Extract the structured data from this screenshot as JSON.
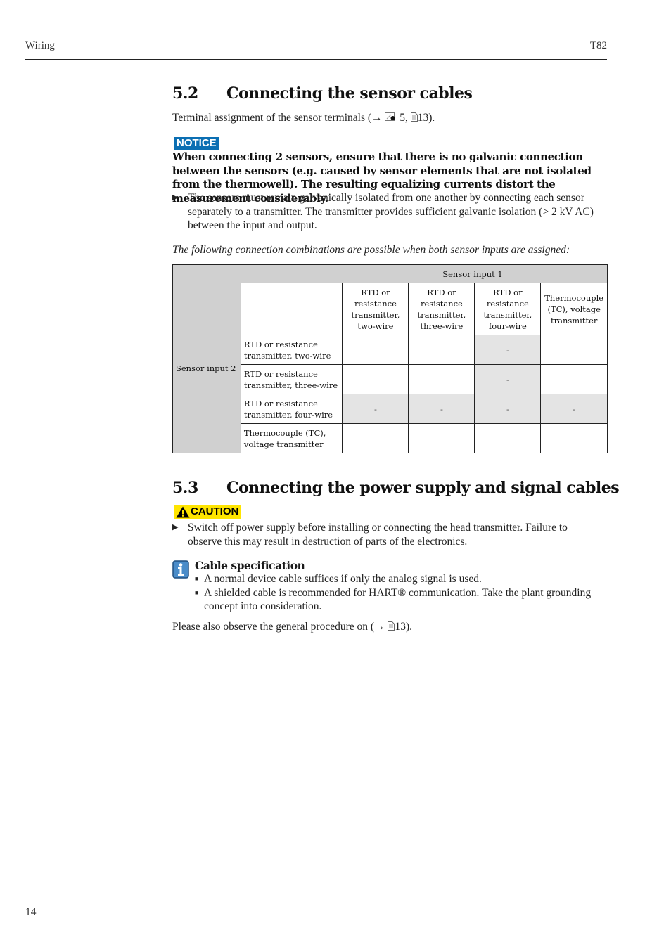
{
  "header": {
    "section": "Wiring",
    "product": "T82"
  },
  "section_52": {
    "number": "5.2",
    "title": "Connecting the sensor cables",
    "intro_prefix": "Terminal assignment of the sensor terminals (",
    "intro_arrow": "→",
    "intro_figure_ref": "5,",
    "intro_page_ref": "13).",
    "notice": {
      "badge": "NOTICE",
      "text": "When connecting 2 sensors, ensure that there is no galvanic connection between the sensors (e.g. caused by sensor elements that are not isolated from the thermowell). The resulting equalizing currents distort the measurement considerably.",
      "action": "The sensors must remain galvanically isolated from one another by connecting each sensor separately to a transmitter. The transmitter provides sufficient galvanic isolation (> 2 kV AC) between the input and output."
    },
    "table_caption": "The following connection combinations are possible when both sensor inputs are assigned:",
    "table": {
      "top_header": "Sensor input 1",
      "side_header": "Sensor input  2",
      "columns": [
        "RTD or resistance transmitter, two-wire",
        "RTD or resistance transmitter, three-wire",
        "RTD or resistance transmitter, four-wire",
        "Thermocouple (TC), voltage transmitter"
      ],
      "rows": [
        {
          "label": "RTD or resistance transmitter, two-wire",
          "cells": [
            "",
            "",
            "-",
            ""
          ]
        },
        {
          "label": "RTD or resistance transmitter, three-wire",
          "cells": [
            "",
            "",
            "-",
            ""
          ]
        },
        {
          "label": "RTD or resistance transmitter, four-wire",
          "cells": [
            "-",
            "-",
            "-",
            "-"
          ]
        },
        {
          "label": "Thermocouple (TC), voltage transmitter",
          "cells": [
            "",
            "",
            "",
            ""
          ]
        }
      ]
    }
  },
  "section_53": {
    "number": "5.3",
    "title": "Connecting the power supply and signal cables",
    "caution": {
      "badge": "CAUTION",
      "action": "Switch off power supply before installing or connecting the head transmitter. Failure to observe this may result in destruction of parts of the electronics."
    },
    "info": {
      "title": "Cable specification",
      "items": [
        "A normal device cable suffices if only the analog signal is used.",
        "A shielded cable is recommended for HART® communication. Take the plant grounding concept into consideration."
      ]
    },
    "closing_prefix": "Please also observe the general procedure on (",
    "closing_arrow": "→",
    "closing_page_ref": "13)."
  },
  "footer": {
    "page_number": "14"
  }
}
